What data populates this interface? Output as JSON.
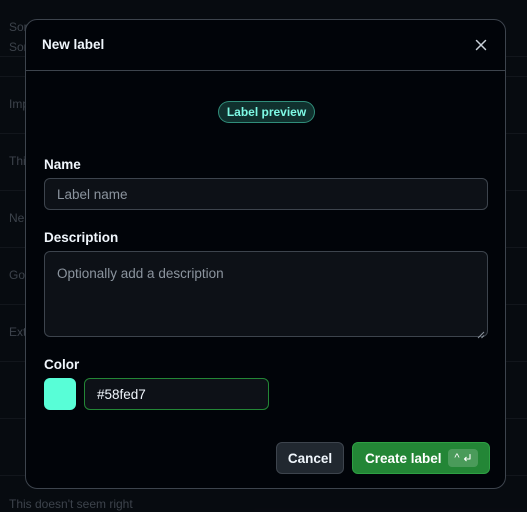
{
  "background": {
    "rows": [
      "Sor",
      "Imp",
      "Thi",
      "Ne",
      "Go",
      "Ext",
      "",
      ""
    ],
    "footer_text": "This doesn't seem right"
  },
  "modal": {
    "title": "New label",
    "close_icon": "close-icon",
    "preview_label": "Label preview",
    "preview_colors": {
      "text": "#7ef9e4",
      "background": "#58fed7"
    },
    "name": {
      "label": "Name",
      "placeholder": "Label name",
      "value": ""
    },
    "description": {
      "label": "Description",
      "placeholder": "Optionally add a description",
      "value": ""
    },
    "color": {
      "label": "Color",
      "value": "#58fed7",
      "swatch": "#58fed7"
    },
    "buttons": {
      "cancel": "Cancel",
      "create": "Create label",
      "shortcut_ctrl": "^",
      "shortcut_enter_icon": "enter-icon"
    }
  },
  "colors": {
    "accent_green": "#238636",
    "border": "#3d444d",
    "surface": "#010409"
  }
}
